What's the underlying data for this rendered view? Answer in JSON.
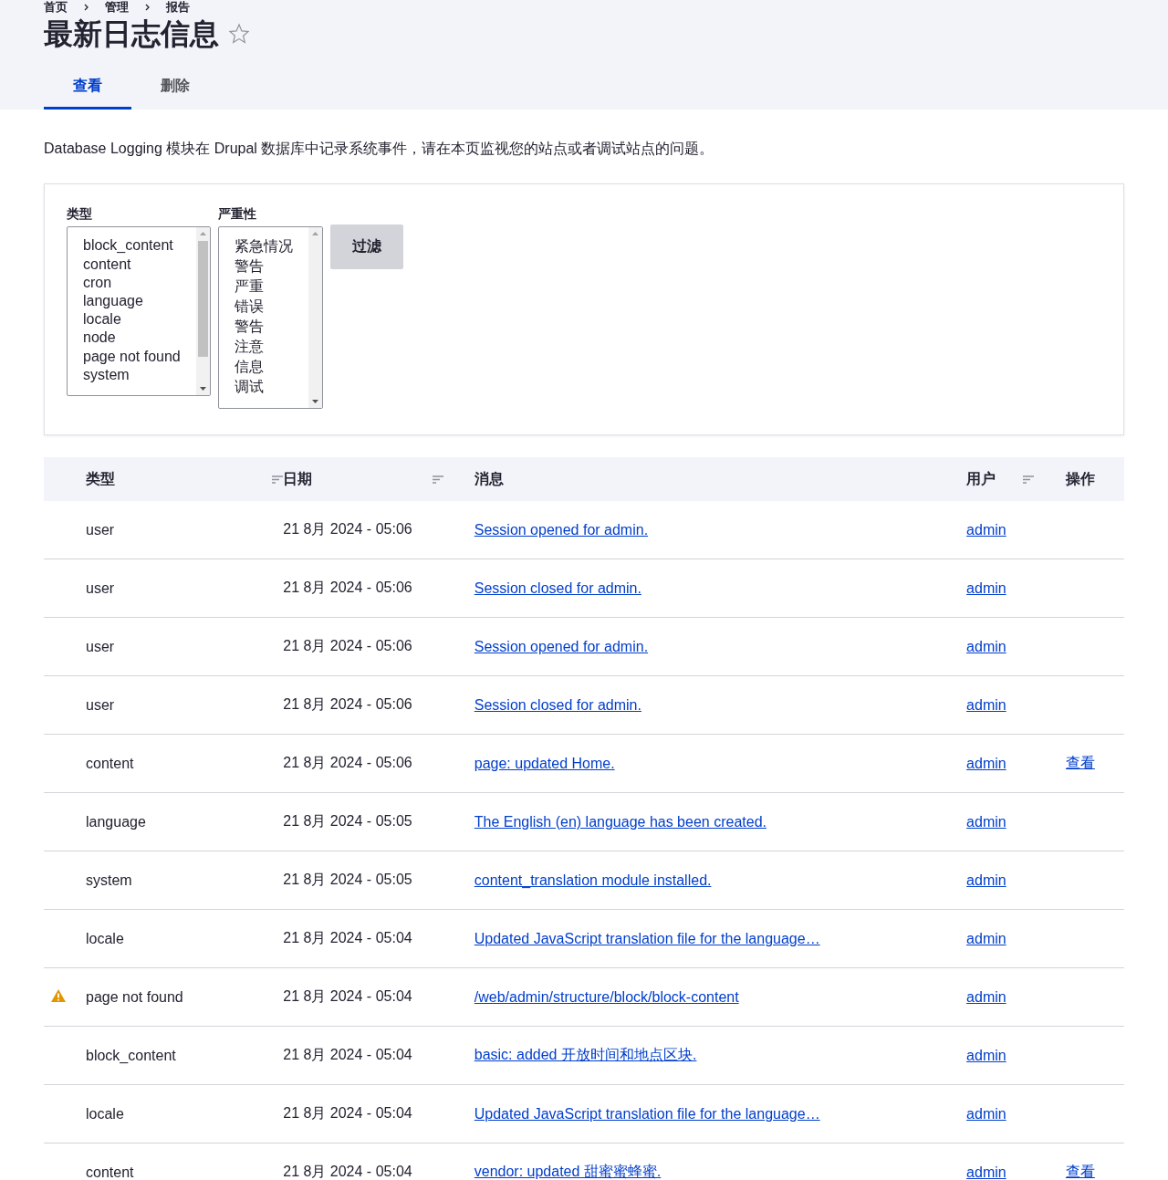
{
  "breadcrumb": [
    "首页",
    "管理",
    "报告"
  ],
  "title": "最新日志信息",
  "favorite": false,
  "tabs": [
    {
      "label": "查看",
      "selected": true
    },
    {
      "label": "删除",
      "selected": false
    }
  ],
  "description": "Database Logging 模块在 Drupal 数据库中记录系统事件，请在本页监视您的站点或者调试站点的问题。",
  "filters": {
    "type": {
      "label": "类型",
      "options": [
        "block_content",
        "content",
        "cron",
        "language",
        "locale",
        "node",
        "page not found",
        "system"
      ]
    },
    "severity": {
      "label": "严重性",
      "options": [
        "紧急情况",
        "警告",
        "严重",
        "错误",
        "警告",
        "注意",
        "信息",
        "调试"
      ]
    },
    "button": "过滤"
  },
  "table": {
    "columns": [
      {
        "label": "类型",
        "sortable": true
      },
      {
        "label": "日期",
        "sortable": true
      },
      {
        "label": "消息",
        "sortable": false
      },
      {
        "label": "用户",
        "sortable": true
      },
      {
        "label": "操作",
        "sortable": false
      }
    ],
    "rows": [
      {
        "warning": false,
        "type": "user",
        "date": "21 8月 2024 - 05:06",
        "message": "Session opened for admin.",
        "user": "admin"
      },
      {
        "warning": false,
        "type": "user",
        "date": "21 8月 2024 - 05:06",
        "message": "Session closed for admin.",
        "user": "admin"
      },
      {
        "warning": false,
        "type": "user",
        "date": "21 8月 2024 - 05:06",
        "message": "Session opened for admin.",
        "user": "admin"
      },
      {
        "warning": false,
        "type": "user",
        "date": "21 8月 2024 - 05:06",
        "message": "Session closed for admin.",
        "user": "admin"
      },
      {
        "warning": false,
        "type": "content",
        "date": "21 8月 2024 - 05:06",
        "message": "page: updated Home.",
        "user": "admin",
        "operation": "查看"
      },
      {
        "warning": false,
        "type": "language",
        "date": "21 8月 2024 - 05:05",
        "message": "The English (en) language has been created.",
        "user": "admin"
      },
      {
        "warning": false,
        "type": "system",
        "date": "21 8月 2024 - 05:05",
        "message": "content_translation module installed.",
        "user": "admin"
      },
      {
        "warning": false,
        "type": "locale",
        "date": "21 8月 2024 - 05:04",
        "message": "Updated JavaScript translation file for the language…",
        "user": "admin"
      },
      {
        "warning": true,
        "type": "page not found",
        "date": "21 8月 2024 - 05:04",
        "message": "/web/admin/structure/block/block-content",
        "user": "admin"
      },
      {
        "warning": false,
        "type": "block_content",
        "date": "21 8月 2024 - 05:04",
        "message": "basic: added 开放时间和地点区块.",
        "user": "admin"
      },
      {
        "warning": false,
        "type": "locale",
        "date": "21 8月 2024 - 05:04",
        "message": "Updated JavaScript translation file for the language…",
        "user": "admin"
      },
      {
        "warning": false,
        "type": "content",
        "date": "21 8月 2024 - 05:04",
        "message": "vendor: updated 甜蜜蜜蜂蜜.",
        "user": "admin",
        "operation": "查看"
      }
    ]
  }
}
